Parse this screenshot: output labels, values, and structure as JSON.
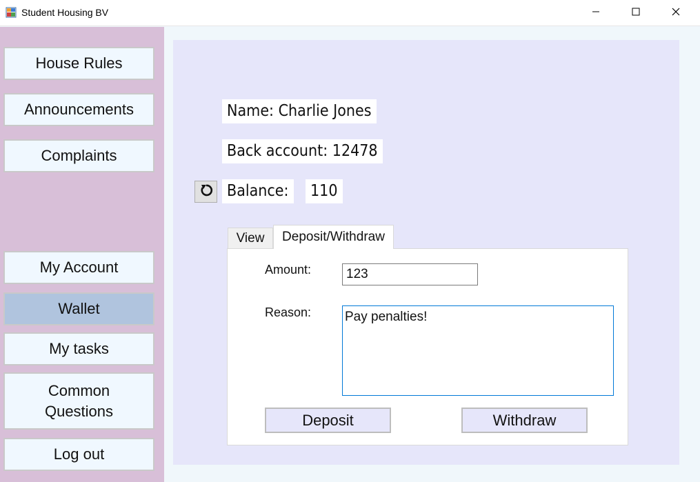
{
  "window": {
    "title": "Student Housing BV",
    "icon": "app-window-icon",
    "controls": [
      "minimize-icon",
      "maximize-icon",
      "close-icon"
    ]
  },
  "sidebar": {
    "background": "#d8bfd8",
    "items": [
      {
        "label": "House Rules",
        "active": false
      },
      {
        "label": "Announcements",
        "active": false
      },
      {
        "label": "Complaints",
        "active": false
      },
      {
        "label": "My Account",
        "active": false
      },
      {
        "label": "Wallet",
        "active": true
      },
      {
        "label": "My tasks",
        "active": false
      },
      {
        "label": "Common Questions",
        "active": false
      },
      {
        "label": "Log out",
        "active": false
      }
    ]
  },
  "account": {
    "name_text": "Name: Charlie Jones",
    "bank_account_text": "Back account: 12478",
    "balance_label": "Balance:",
    "balance_value": "110",
    "refresh_icon": "refresh-icon"
  },
  "tabs": [
    {
      "label": "View",
      "selected": false
    },
    {
      "label": "Deposit/Withdraw",
      "selected": true
    }
  ],
  "form": {
    "amount_label": "Amount:",
    "amount_value": "123",
    "reason_label": "Reason:",
    "reason_value": "Pay penalties!",
    "deposit_label": "Deposit",
    "withdraw_label": "Withdraw"
  },
  "colors": {
    "main_panel": "#e6e6fa",
    "sidebar_button": "#f0f8ff",
    "active_button": "#b0c4de",
    "focus_border": "#0078d7"
  }
}
